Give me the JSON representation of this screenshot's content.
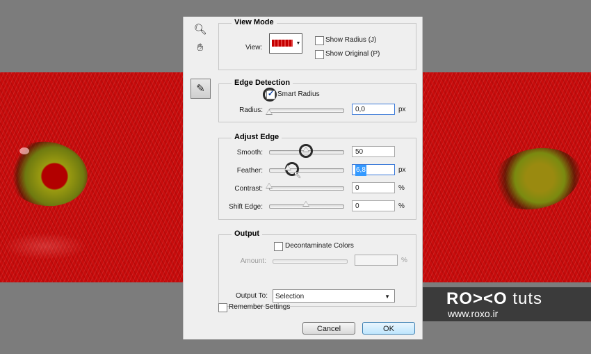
{
  "dialog": {
    "tools": {
      "zoom_icon": "magnifier-icon",
      "hand_icon": "hand-icon",
      "brush_icon": "refine-radius-brush-icon"
    },
    "view_mode": {
      "title": "View Mode",
      "view_label": "View:",
      "show_radius": "Show Radius (J)",
      "show_radius_checked": false,
      "show_original": "Show Original (P)",
      "show_original_checked": false
    },
    "edge_detection": {
      "title": "Edge Detection",
      "smart_radius": "Smart Radius",
      "smart_radius_checked": true,
      "radius_label": "Radius:",
      "radius_value": "0,0",
      "radius_unit": "px",
      "radius_level": 0
    },
    "adjust_edge": {
      "title": "Adjust Edge",
      "smooth_label": "Smooth:",
      "smooth_value": "50",
      "smooth_level": 0.5,
      "feather_label": "Feather:",
      "feather_value": "6,8",
      "feather_unit": "px",
      "feather_level": 0.25,
      "contrast_label": "Contrast:",
      "contrast_value": "0",
      "contrast_unit": "%",
      "contrast_level": 0,
      "shift_label": "Shift Edge:",
      "shift_value": "0",
      "shift_unit": "%",
      "shift_level": 0.5
    },
    "output": {
      "title": "Output",
      "decontaminate": "Decontaminate Colors",
      "decontaminate_checked": false,
      "amount_label": "Amount:",
      "amount_unit": "%",
      "output_to_label": "Output To:",
      "output_to_value": "Selection"
    },
    "remember": "Remember Settings",
    "remember_checked": false,
    "cancel": "Cancel",
    "ok": "OK"
  },
  "brand": {
    "logo_name": "RO><O",
    "logo_suffix": "tuts",
    "url": "www.roxo.ir"
  },
  "colors": {
    "selection_overlay": "#c80c0c",
    "accent": "#3399ff"
  }
}
